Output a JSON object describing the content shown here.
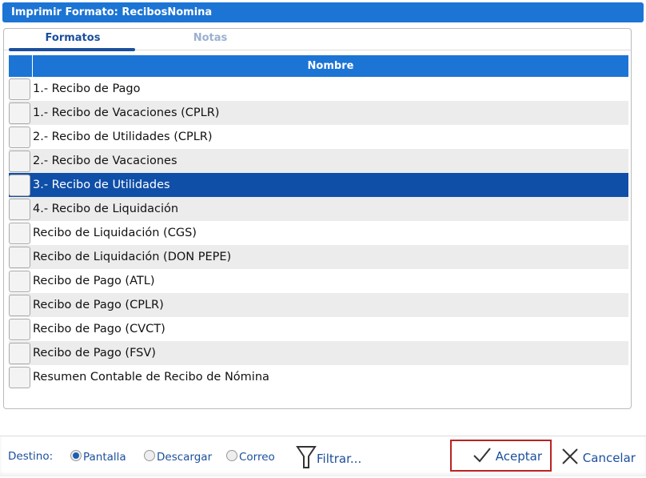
{
  "window": {
    "title": "Imprimir Formato: RecibosNomina"
  },
  "tabs": [
    {
      "label": "Formatos",
      "active": true
    },
    {
      "label": "Notas",
      "active": false
    }
  ],
  "table": {
    "header": "Nombre",
    "selected_index": 4,
    "rows": [
      "1.- Recibo de Pago",
      "1.- Recibo de Vacaciones (CPLR)",
      "2.- Recibo de Utilidades (CPLR)",
      "2.- Recibo de Vacaciones",
      "3.- Recibo de Utilidades",
      "4.- Recibo de Liquidación",
      "Recibo de Liquidación (CGS)",
      "Recibo de Liquidación (DON PEPE)",
      "Recibo de Pago (ATL)",
      "Recibo de Pago (CPLR)",
      "Recibo de Pago (CVCT)",
      "Recibo de Pago (FSV)",
      "Resumen Contable de Recibo de Nómina"
    ]
  },
  "footer": {
    "destino_label": "Destino:",
    "options": [
      "Pantalla",
      "Descargar",
      "Correo"
    ],
    "selected": "Pantalla",
    "filter_label": "Filtrar...",
    "accept_label": "Aceptar",
    "cancel_label": "Cancelar"
  }
}
